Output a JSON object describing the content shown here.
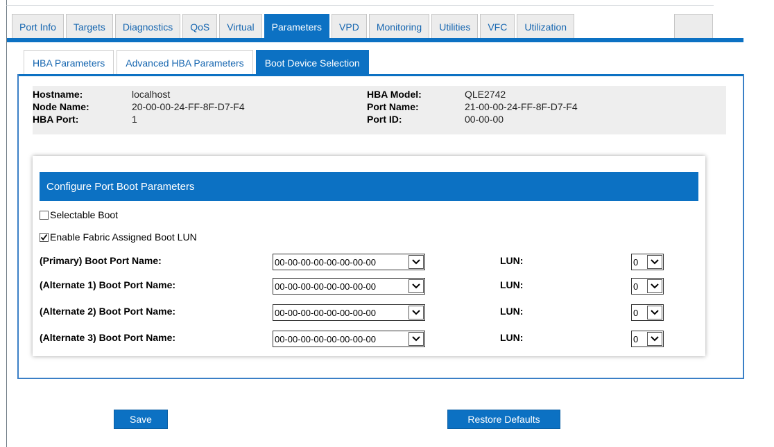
{
  "main_tabs": [
    {
      "label": "Port Info"
    },
    {
      "label": "Targets"
    },
    {
      "label": "Diagnostics"
    },
    {
      "label": "QoS"
    },
    {
      "label": "Virtual"
    },
    {
      "label": "Parameters",
      "active": true
    },
    {
      "label": "VPD"
    },
    {
      "label": "Monitoring"
    },
    {
      "label": "Utilities"
    },
    {
      "label": "VFC"
    },
    {
      "label": "Utilization"
    }
  ],
  "sub_tabs": [
    {
      "label": "HBA Parameters"
    },
    {
      "label": "Advanced HBA Parameters"
    },
    {
      "label": "Boot Device Selection",
      "active": true
    }
  ],
  "info": {
    "hostname_label": "Hostname:",
    "hostname_value": "localhost",
    "node_name_label": "Node Name:",
    "node_name_value": "20-00-00-24-FF-8F-D7-F4",
    "hba_port_label": "HBA Port:",
    "hba_port_value": "1",
    "hba_model_label": "HBA Model:",
    "hba_model_value": "QLE2742",
    "port_name_label": "Port Name:",
    "port_name_value": "21-00-00-24-FF-8F-D7-F4",
    "port_id_label": "Port ID:",
    "port_id_value": "00-00-00"
  },
  "boot_config": {
    "title": "Configure Port Boot Parameters",
    "selectable_boot_label": "Selectable Boot",
    "selectable_boot_checked": false,
    "fabric_boot_label": "Enable Fabric Assigned Boot LUN",
    "fabric_boot_checked": true,
    "lun_label": "LUN:",
    "rows": [
      {
        "label": "(Primary) Boot Port Name:",
        "wwn": "00-00-00-00-00-00-00-00",
        "lun": "0"
      },
      {
        "label": "(Alternate 1) Boot Port Name:",
        "wwn": "00-00-00-00-00-00-00-00",
        "lun": "0"
      },
      {
        "label": "(Alternate 2) Boot Port Name:",
        "wwn": "00-00-00-00-00-00-00-00",
        "lun": "0"
      },
      {
        "label": "(Alternate 3) Boot Port Name:",
        "wwn": "00-00-00-00-00-00-00-00",
        "lun": "0"
      }
    ]
  },
  "actions": {
    "save_label": "Save",
    "restore_label": "Restore Defaults"
  },
  "colors": {
    "accent": "#0c71c3",
    "link": "#1666b0",
    "info_bg": "#eeeeee"
  }
}
